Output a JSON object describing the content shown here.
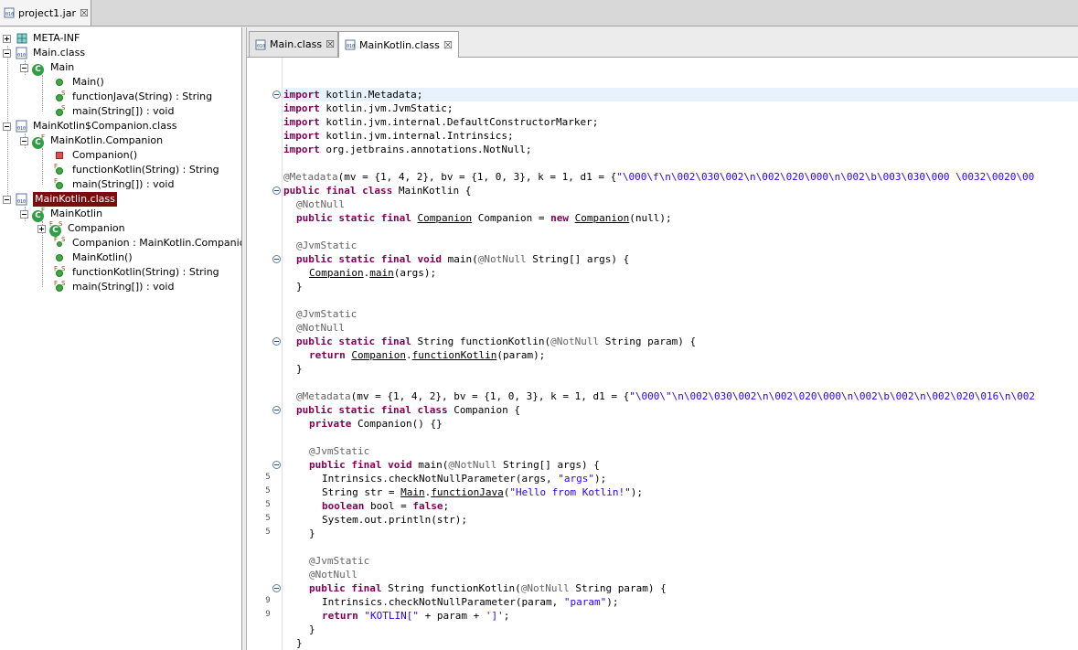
{
  "outer_tab": {
    "label": "project1.jar",
    "close": "☒"
  },
  "tree": {
    "meta_inf": "META-INF",
    "main_class": "Main.class",
    "main": "Main",
    "main_ctor": "Main()",
    "main_fjava": "functionJava(String) : String",
    "main_main": "main(String[]) : void",
    "companion_class": "MainKotlin$Companion.class",
    "companion_type": "MainKotlin.Companion",
    "companion_ctor": "Companion()",
    "companion_fk": "functionKotlin(String) : String",
    "companion_main": "main(String[]) : void",
    "mainkotlin_class": "MainKotlin.class",
    "mainkotlin": "MainKotlin",
    "mk_companion": "Companion",
    "mk_companion_field": "Companion : MainKotlin.Companion",
    "mk_ctor": "MainKotlin()",
    "mk_fk": "functionKotlin(String) : String",
    "mk_main": "main(String[]) : void"
  },
  "editor_tabs": [
    {
      "label": "Main.class",
      "close": "☒"
    },
    {
      "label": "MainKotlin.class",
      "close": "☒"
    }
  ],
  "gutter_numbers": [
    "5",
    "5",
    "5",
    "5",
    "5",
    "9",
    "9"
  ],
  "code": {
    "l1_kw": "import",
    "l1_rest": " kotlin.Metadata;",
    "l2_kw": "import",
    "l2_rest": " kotlin.jvm.JvmStatic;",
    "l3_kw": "import",
    "l3_rest": " kotlin.jvm.internal.DefaultConstructorMarker;",
    "l4_kw": "import",
    "l4_rest": " kotlin.jvm.internal.Intrinsics;",
    "l5_kw": "import",
    "l5_rest": " org.jetbrains.annotations.NotNull;",
    "l7_an": "@Metadata",
    "l7_rest": "(mv = {1, 4, 2}, bv = {1, 0, 3}, k = 1, d1 = {",
    "l7_st": "\"\\000\\f\\n\\002\\030\\002\\n\\002\\020\\000\\n\\002\\b\\003\\030\\000 \\0032\\0020\\00",
    "l8_kw": "public final class",
    "l8_rest": " MainKotlin {",
    "l9_an": "@NotNull",
    "l10_kw": "public static final",
    "l10_a": "Companion",
    "l10_b": " Companion = ",
    "l10_kw2": "new",
    "l10_c": "Companion",
    "l10_d": "(null);",
    "l12_an": "@JvmStatic",
    "l13_kw": "public static final void",
    "l13_a": " main(",
    "l13_an": "@NotNull",
    "l13_b": " String[] args) {",
    "l14_a": "Companion",
    "l14_b": ".",
    "l14_c": "main",
    "l14_d": "(args);",
    "l15": "}",
    "l17_an": "@JvmStatic",
    "l18_an": "@NotNull",
    "l19_kw": "public static final",
    "l19_a": " String functionKotlin(",
    "l19_an": "@NotNull",
    "l19_b": " String param) {",
    "l20_kw": "return",
    "l20_a": "Companion",
    "l20_b": ".",
    "l20_c": "functionKotlin",
    "l20_d": "(param);",
    "l21": "}",
    "l23_an": "@Metadata",
    "l23_rest": "(mv = {1, 4, 2}, bv = {1, 0, 3}, k = 1, d1 = {",
    "l23_st": "\"\\000\\\"\\n\\002\\030\\002\\n\\002\\020\\000\\n\\002\\b\\002\\n\\002\\020\\016\\n\\002",
    "l24_kw": "public static final class",
    "l24_rest": " Companion {",
    "l25_kw": "private",
    "l25_rest": " Companion() {}",
    "l27_an": "@JvmStatic",
    "l28_kw": "public final void",
    "l28_a": " main(",
    "l28_an": "@NotNull",
    "l28_b": " String[] args) {",
    "l29_a": "Intrinsics.checkNotNullParameter(args, ",
    "l29_st": "\"args\"",
    "l29_b": ");",
    "l30_a": "String str = ",
    "l30_b": "Main",
    "l30_c": ".",
    "l30_d": "functionJava",
    "l30_e": "(",
    "l30_st": "\"Hello from Kotlin!\"",
    "l30_f": ");",
    "l31_kw": "boolean",
    "l31_a": " bool = ",
    "l31_kw2": "false",
    "l31_b": ";",
    "l32": "System.out.println(str);",
    "l33": "}",
    "l35_an": "@JvmStatic",
    "l36_an": "@NotNull",
    "l37_kw": "public final",
    "l37_a": " String functionKotlin(",
    "l37_an": "@NotNull",
    "l37_b": " String param) {",
    "l38_a": "Intrinsics.checkNotNullParameter(param, ",
    "l38_st": "\"param\"",
    "l38_b": ");",
    "l39_kw": "return",
    "l39_a": " ",
    "l39_st": "\"KOTLIN[\"",
    "l39_b": " + param + ",
    "l39_st2": "']'",
    "l39_c": ";",
    "l40": "}",
    "l41": "}",
    "l42": "}"
  }
}
